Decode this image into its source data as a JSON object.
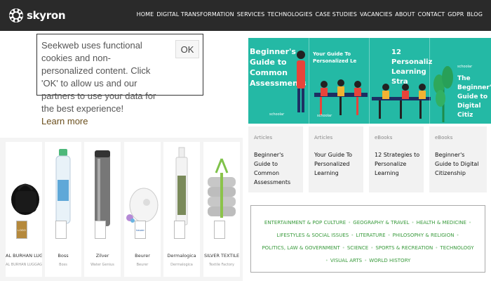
{
  "brand": {
    "name": "skyron"
  },
  "nav": {
    "items": [
      {
        "label": "HOME"
      },
      {
        "label": "DIGITAL TRANSFORMATION"
      },
      {
        "label": "SERVICES"
      },
      {
        "label": "TECHNOLOGIES"
      },
      {
        "label": "CASE STUDIES"
      },
      {
        "label": "VACANCIES"
      },
      {
        "label": "ABOUT"
      },
      {
        "label": "CONTACT"
      },
      {
        "label": "GDPR"
      },
      {
        "label": "BLOG"
      }
    ]
  },
  "cookie": {
    "message": "Seekweb uses functional cookies and non-personalized content. Click 'OK' to allow us and our partners to use your data for the best experience!",
    "link_label": "Learn more",
    "ok_label": "OK"
  },
  "products": [
    {
      "name": "AL BURHAN LUGGAGE",
      "brand": "AL BURHAN LUGGAGE",
      "logo": "LOGO"
    },
    {
      "name": "Boss",
      "brand": "Boss",
      "logo": ""
    },
    {
      "name": "Zilver",
      "brand": "Water Genius",
      "logo": ""
    },
    {
      "name": "Beurer",
      "brand": "Beurer",
      "logo": "beurer"
    },
    {
      "name": "Dermalogica",
      "brand": "Dermalogica",
      "logo": ""
    },
    {
      "name": "SILVER TEXTILE",
      "brand": "Textile Factory",
      "logo": ""
    }
  ],
  "banners": [
    {
      "title": "Beginner's Guide to Common Assessments",
      "small": "schoolar"
    },
    {
      "title": "Your Guide To Personalized Le",
      "small": "schoolar"
    },
    {
      "title": "12 Personaliz Learning Stra",
      "small": ""
    },
    {
      "title": "The Beginner's Guide to Digital Citiz",
      "small": "schoolar"
    }
  ],
  "cards": [
    {
      "category": "Articles",
      "title": "Beginner's Guide to Common Assessments"
    },
    {
      "category": "Articles",
      "title": "Your Guide To Personalized Learning"
    },
    {
      "category": "eBooks",
      "title": "12 Strategies to Personalize Learning"
    },
    {
      "category": "eBooks",
      "title": "Beginner's Guide to Digital Citizenship"
    }
  ],
  "categories": [
    "ENTERTAINMENT & POP CULTURE",
    "GEOGRAPHY & TRAVEL",
    "HEALTH & MEDICINE",
    "LIFESTYLES & SOCIAL ISSUES",
    "LITERATURE",
    "PHILOSOPHY & RELIGION",
    "POLITICS, LAW & GOVERNMENT",
    "SCIENCE",
    "SPORTS & RECREATION",
    "TECHNOLOGY",
    "VISUAL ARTS",
    "WORLD HISTORY"
  ],
  "colors": {
    "topbar": "#2a2a2a",
    "banner_teal": "#24b9a5",
    "category_green": "#3a9b3d",
    "cookie_link": "#6b4f1d"
  }
}
